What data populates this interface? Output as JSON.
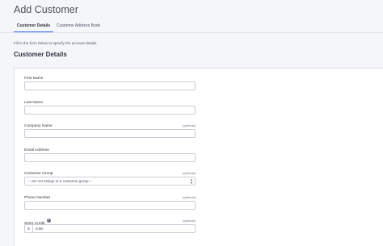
{
  "page": {
    "title": "Add Customer"
  },
  "tabs": [
    {
      "label": "Customer Details",
      "active": true
    },
    {
      "label": "Customer Address Book",
      "active": false
    }
  ],
  "intro_text": "Fill in the form below to specify the account details.",
  "section_heading": "Customer Details",
  "fields": {
    "first_name": {
      "label": "First Name",
      "value": ""
    },
    "last_name": {
      "label": "Last Name",
      "value": ""
    },
    "company_name": {
      "label": "Company Name",
      "optional": "(optional)",
      "value": ""
    },
    "email": {
      "label": "Email Address",
      "value": ""
    },
    "customer_group": {
      "label": "Customer Group",
      "optional": "(optional)",
      "selected": "-- Do not assign to a customer group --"
    },
    "phone": {
      "label": "Phone Number",
      "optional": "(optional)",
      "value": ""
    },
    "store_credit": {
      "label": "Store Credit",
      "optional": "(optional)",
      "prefix": "$",
      "value": "0.00"
    }
  },
  "colors": {
    "accent": "#3c64f4",
    "background": "#f5f6f9",
    "card": "#ffffff",
    "border": "#c9ccd6"
  },
  "icons": {
    "help": "help-circle-icon",
    "select": "up-down-arrows-icon"
  }
}
